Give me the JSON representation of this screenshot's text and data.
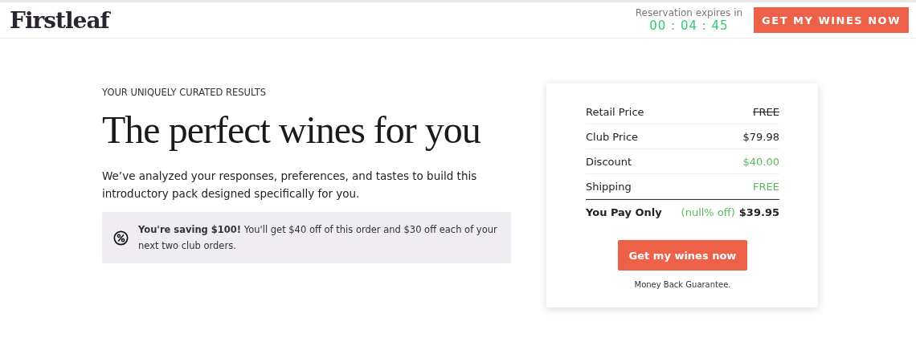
{
  "header": {
    "logo": "Firstleaf",
    "timer_label": "Reservation expires in",
    "timer": "00 : 04 : 45",
    "cta": "GET MY WINES NOW"
  },
  "intro": {
    "eyebrow": "YOUR UNIQUELY CURATED RESULTS",
    "headline": "The perfect wines for you",
    "body": "We’ve analyzed your responses, preferences, and tastes to build this introductory pack designed specifically for you."
  },
  "savings": {
    "text": "**You're saving $100!** You'll get $40 off of this order and $30 off each of your next two club orders."
  },
  "summary": {
    "rows": [
      {
        "label": "Retail Price",
        "value": "FREE",
        "kind": "strike"
      },
      {
        "label": "Club Price",
        "value": "$79.98",
        "kind": "plain"
      },
      {
        "label": "Discount",
        "value": "$40.00",
        "kind": "green"
      },
      {
        "label": "Shipping",
        "value": "FREE",
        "kind": "green"
      }
    ],
    "total": {
      "label": "You Pay Only",
      "note": "(null% off)",
      "value": "$39.95"
    },
    "button": "Get my wines now",
    "guarantee": "Money Back Guarantee."
  }
}
